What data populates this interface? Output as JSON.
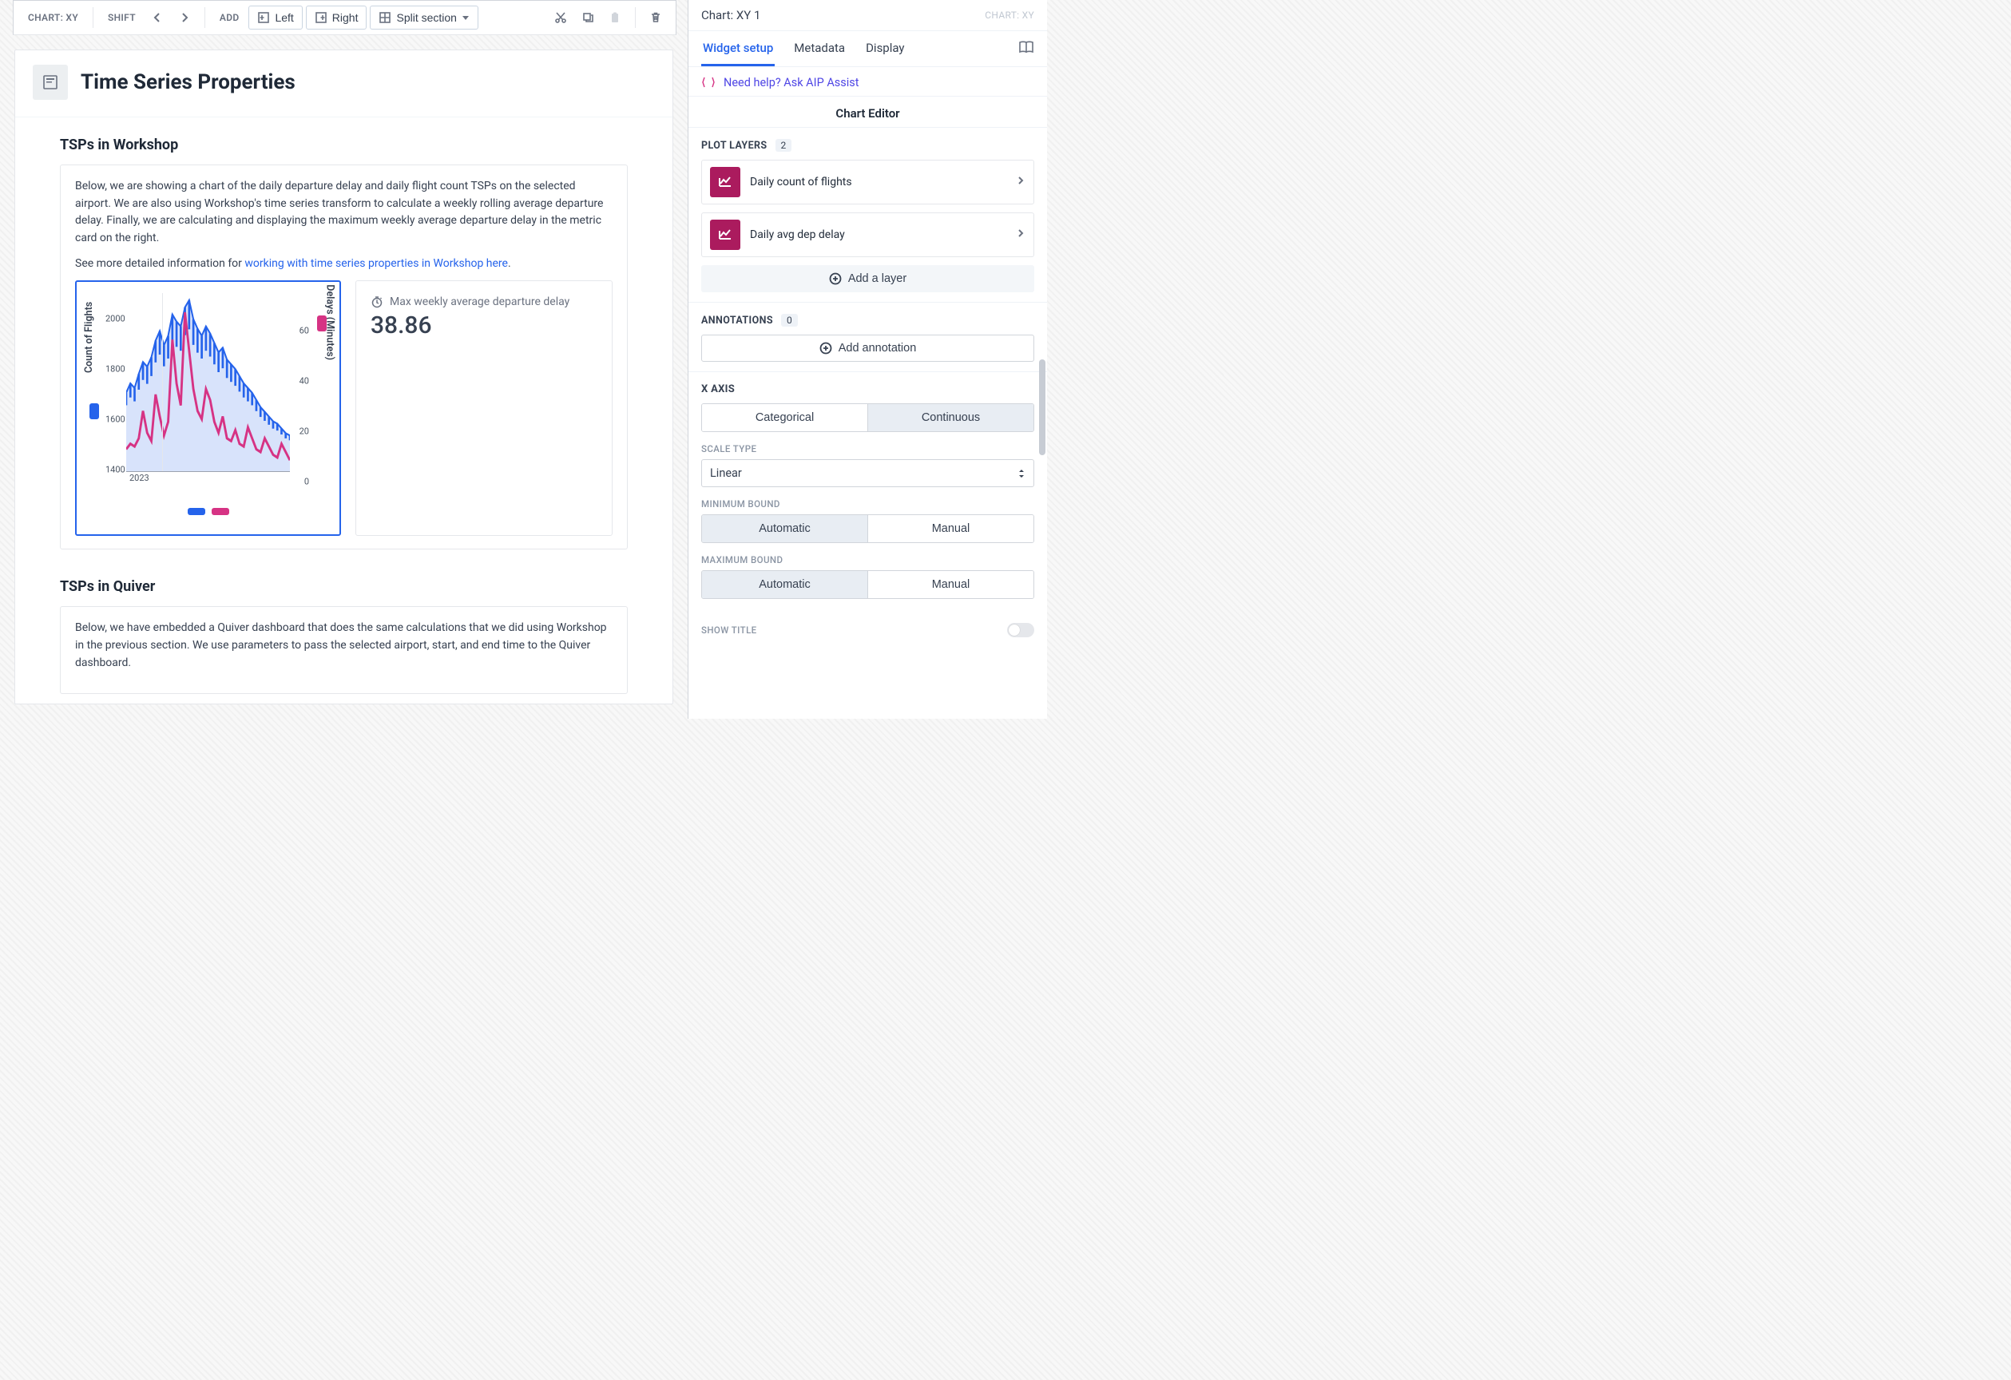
{
  "toolbar": {
    "chart_label": "CHART: XY",
    "shift_label": "SHIFT",
    "add_label": "ADD",
    "left_btn": "Left",
    "right_btn": "Right",
    "split_btn": "Split section"
  },
  "page": {
    "title": "Time Series Properties",
    "section1_title": "TSPs in Workshop",
    "section1_p1": "Below, we are showing a chart of the daily departure delay and daily flight count TSPs on the selected airport. We are also using Workshop's time series transform to calculate a weekly rolling average departure delay. Finally, we are calculating and displaying the maximum weekly average departure delay in the metric card on the right.",
    "section1_p2_a": "See more detailed information for ",
    "section1_link": "working with time series properties in Workshop here",
    "section1_p2_b": ".",
    "metric_label": "Max weekly average departure delay",
    "metric_value": "38.86",
    "section2_title": "TSPs in Quiver",
    "section2_p1": "Below, we have embedded a Quiver dashboard that does the same calculations that we did using Workshop in the previous section. We use parameters to pass the selected airport, start, and end time to the Quiver dashboard."
  },
  "chart_data": {
    "type": "line",
    "title": "",
    "x_tick": "2023",
    "y_left": {
      "label": "Count of Flights",
      "ticks": [
        1400,
        1600,
        1800,
        2000
      ]
    },
    "y_right": {
      "label": "Delays (Minutes)",
      "ticks": [
        0,
        20,
        40,
        60
      ]
    },
    "series": [
      {
        "name": "Count of Flights",
        "color": "#2563eb",
        "values": [
          1680,
          1720,
          1700,
          1760,
          1810,
          1790,
          1830,
          1900,
          1940,
          1880,
          1920,
          2010,
          1980,
          1960,
          2040,
          2070,
          1990,
          1950,
          1920,
          1960,
          1930,
          1890,
          1850,
          1870,
          1820,
          1800,
          1780,
          1750,
          1720,
          1700,
          1680,
          1650,
          1620,
          1600,
          1580,
          1560,
          1550,
          1530,
          1510,
          1500
        ]
      },
      {
        "name": "Delays (Minutes)",
        "color": "#d63384",
        "values": [
          8,
          10,
          9,
          12,
          22,
          14,
          11,
          28,
          20,
          13,
          18,
          48,
          32,
          24,
          58,
          44,
          30,
          22,
          19,
          30,
          26,
          18,
          14,
          20,
          12,
          11,
          15,
          10,
          9,
          16,
          12,
          8,
          7,
          12,
          9,
          6,
          5,
          10,
          7,
          4
        ]
      }
    ]
  },
  "right": {
    "breadcrumb": "CHART: XY",
    "title": "Chart: XY 1",
    "tabs": {
      "setup": "Widget setup",
      "metadata": "Metadata",
      "display": "Display"
    },
    "help_text": "Need help? Ask AIP Assist",
    "editor_title": "Chart Editor",
    "plot_layers_label": "PLOT LAYERS",
    "plot_layers_count": "2",
    "layers": [
      {
        "label": "Daily count of flights"
      },
      {
        "label": "Daily avg dep delay"
      }
    ],
    "add_layer": "Add a layer",
    "annotations_label": "ANNOTATIONS",
    "annotations_count": "0",
    "add_annotation": "Add annotation",
    "xaxis_label": "X AXIS",
    "seg_cat": "Categorical",
    "seg_cont": "Continuous",
    "scale_type_label": "SCALE TYPE",
    "scale_type_value": "Linear",
    "min_bound_label": "MINIMUM BOUND",
    "max_bound_label": "MAXIMUM BOUND",
    "seg_auto": "Automatic",
    "seg_manual": "Manual",
    "show_title_label": "SHOW TITLE"
  }
}
